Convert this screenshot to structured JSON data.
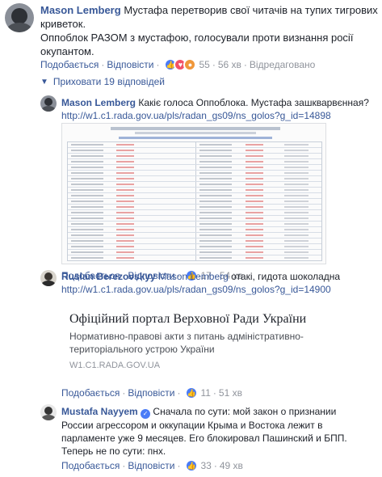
{
  "comment1": {
    "author": "Mason Lemberg",
    "text_line1": "Мустафа перетворив свої читачів на тупих тигрових",
    "text_line2": "криветок.",
    "text_line3": "Оппоблок РАЗОМ з мустафою, голосували проти визнання росії",
    "text_line4": "окупантом.",
    "like": "Подобається",
    "reply": "Відповісти",
    "count": "55",
    "time": "56 хв",
    "edited": "Відредаговано"
  },
  "hide_replies": "Приховати 19 відповідей",
  "reply1": {
    "author": "Mason Lemberg",
    "text": "Какіє голоса Оппоблока. Мустафа зашкварвєнная?",
    "url": "http://w1.c1.rada.gov.ua/pls/radan_gs09/ns_golos?g_id=14898",
    "like": "Подобається",
    "reply": "Відповісти",
    "count": "17",
    "time": "54 хв"
  },
  "reply2": {
    "author": "Ruslan Berezovskyy",
    "mention": "Mason Lemberg",
    "text": "отакі, гидота шоколадна",
    "url": "http://w1.c1.rada.gov.ua/pls/radan_gs09/ns_golos?g_id=14900",
    "preview_title": "Офіційний портал Верховної Ради України",
    "preview_desc1": "Нормативно-правові акти з питань адміністративно-",
    "preview_desc2": "територіального устрою України",
    "preview_domain": "W1.C1.RADA.GOV.UA",
    "like": "Подобається",
    "reply": "Відповісти",
    "count": "11",
    "time": "51 хв"
  },
  "reply3": {
    "author": "Mustafa Nayyem",
    "text_line1": "Сначала по сути: мой закон о признании",
    "text_line2": "России агрессором и оккупации Крыма и Востока лежит в",
    "text_line3": "парламенте уже 9 месяцев. Его блокировал Пашинский и БПП.",
    "text_line4": "Теперь не по сути: пнх.",
    "like": "Подобається",
    "reply": "Відповісти",
    "count": "33",
    "time": "49 хв"
  },
  "colors": {
    "link": "#385898",
    "muted": "#90949c",
    "like": "#4a7cf7"
  }
}
